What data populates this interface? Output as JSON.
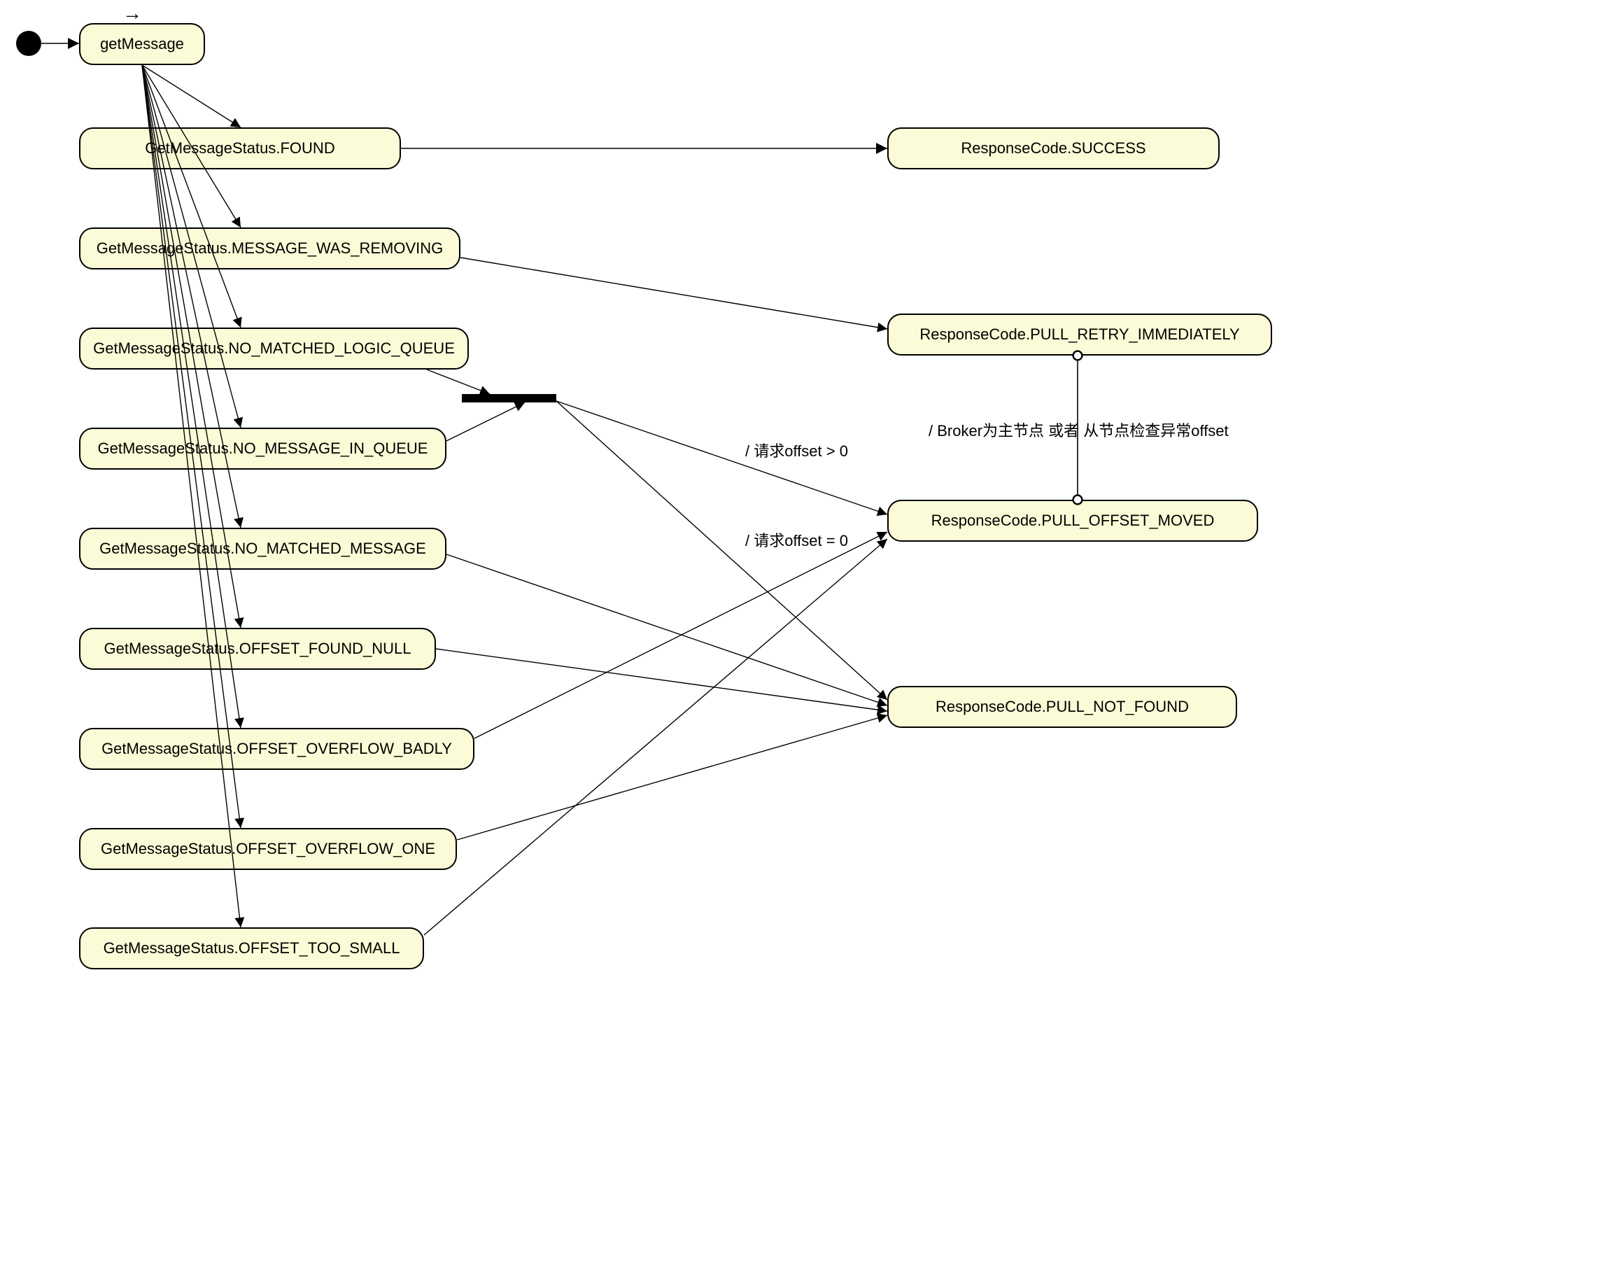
{
  "diagram": {
    "type": "activity",
    "start": "getMessage",
    "nodes": {
      "getMessage": "getMessage",
      "found": "GetMessageStatus.FOUND",
      "removing": "GetMessageStatus.MESSAGE_WAS_REMOVING",
      "noLogic": "GetMessageStatus.NO_MATCHED_LOGIC_QUEUE",
      "noMsg": "GetMessageStatus.NO_MESSAGE_IN_QUEUE",
      "noMatched": "GetMessageStatus.NO_MATCHED_MESSAGE",
      "offNull": "GetMessageStatus.OFFSET_FOUND_NULL",
      "offOverBadly": "GetMessageStatus.OFFSET_OVERFLOW_BADLY",
      "offOverOne": "GetMessageStatus.OFFSET_OVERFLOW_ONE",
      "offTooSmall": "GetMessageStatus.OFFSET_TOO_SMALL",
      "rcSuccess": "ResponseCode.SUCCESS",
      "rcRetry": "ResponseCode.PULL_RETRY_IMMEDIATELY",
      "rcMoved": "ResponseCode.PULL_OFFSET_MOVED",
      "rcNotFound": "ResponseCode.PULL_NOT_FOUND"
    },
    "labels": {
      "offsetGt0": "/ 请求offset > 0",
      "offsetEq0": "/ 请求offset = 0",
      "brokerMaster": "/ Broker为主节点 或者 从节点检查异常offset",
      "arrowGlyph": "→"
    }
  }
}
